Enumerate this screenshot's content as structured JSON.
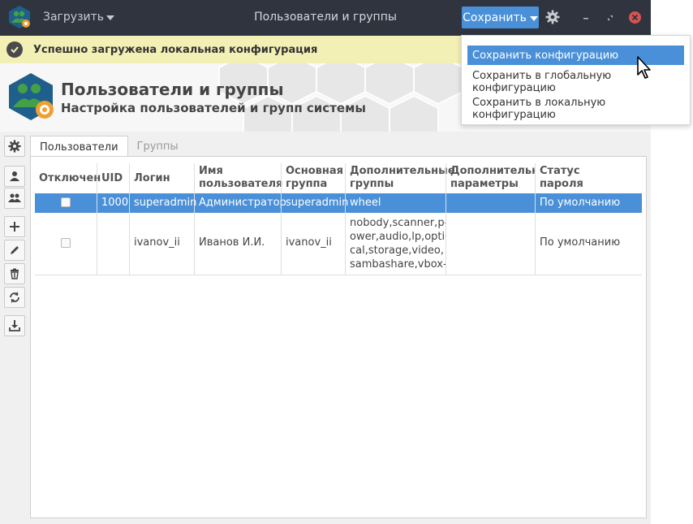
{
  "titlebar": {
    "load_label": "Загрузить",
    "title": "Пользователи и группы",
    "save_label": "Сохранить"
  },
  "notification": {
    "text": "Успешно загружена локальная конфигурация"
  },
  "header": {
    "title": "Пользователи и группы",
    "subtitle": "Настройка пользователей и групп системы"
  },
  "tabs": [
    {
      "label": "Пользователи",
      "active": true
    },
    {
      "label": "Группы",
      "active": false
    }
  ],
  "table": {
    "columns": [
      {
        "line1": "Отключен",
        "line2": ""
      },
      {
        "line1": "UID",
        "line2": ""
      },
      {
        "line1": "Логин",
        "line2": ""
      },
      {
        "line1": "Имя",
        "line2": "пользователя"
      },
      {
        "line1": "Основная",
        "line2": "группа"
      },
      {
        "line1": "Дополнительные",
        "line2": "группы"
      },
      {
        "line1": "Дополнительны",
        "line2": "параметры"
      },
      {
        "line1": "Статус",
        "line2": "пароля"
      }
    ],
    "rows": [
      {
        "disabled": false,
        "uid": "1000",
        "login": "superadmin",
        "name": "Администратор",
        "primary_group": "superadmin",
        "extra_groups": [
          "wheel"
        ],
        "extra_params": "",
        "password_status": "По умолчанию",
        "selected": true
      },
      {
        "disabled": false,
        "uid": "",
        "login": "ivanov_ii",
        "name": "Иванов И.И.",
        "primary_group": "ivanov_ii",
        "extra_groups": [
          "nobody,scanner,p-",
          "ower,audio,lp,opti-",
          "cal,storage,video,",
          "sambashare,vbox-"
        ],
        "extra_params": "",
        "password_status": "По умолчанию",
        "selected": false
      }
    ]
  },
  "save_menu": {
    "items": [
      {
        "label": "Сохранить конфигурацию",
        "selected": true
      },
      {
        "label": "Сохранить в глобальную конфигурацию",
        "selected": false
      },
      {
        "label": "Сохранить в локальную конфигурацию",
        "selected": false
      }
    ]
  },
  "colors": {
    "titlebar": "#2f343f",
    "accent": "#4a90d9",
    "notification": "#f3f0b6",
    "close": "#d9534f",
    "logo_green": "#43a047",
    "logo_blue": "#1f5f8b",
    "logo_orange": "#f0a030"
  },
  "icons": {
    "titlebar": [
      "app-logo-icon",
      "caret-down-icon",
      "settings-gear-icon",
      "minimize-icon",
      "maximize-icon",
      "close-icon"
    ],
    "toolbar": [
      "settings-icon",
      "user-icon",
      "group-icon",
      "add-icon",
      "edit-icon",
      "delete-icon",
      "refresh-icon",
      "download-icon"
    ]
  }
}
